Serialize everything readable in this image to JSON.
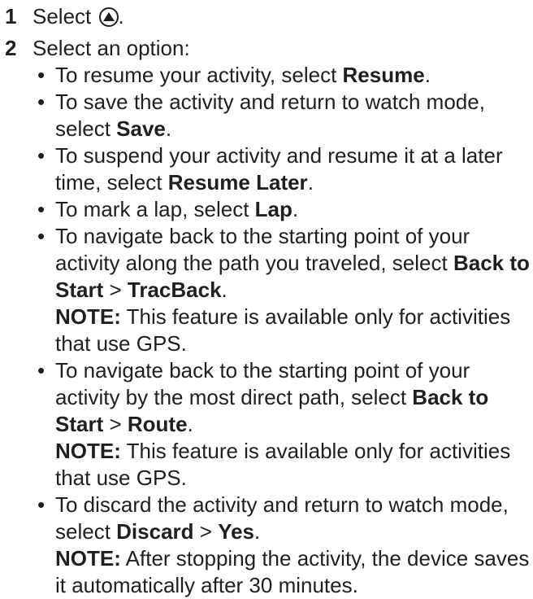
{
  "steps": [
    {
      "number": "1",
      "text_before": "Select ",
      "icon": "up-arrow-button-icon",
      "text_after": "."
    },
    {
      "number": "2",
      "text": "Select an option:",
      "options": [
        {
          "parts": [
            "To resume your activity, select ",
            "Resume",
            "."
          ]
        },
        {
          "parts": [
            "To save the activity and return to watch mode, select ",
            "Save",
            "."
          ]
        },
        {
          "parts": [
            "To suspend your activity and resume it at a later time, select ",
            "Resume Later",
            "."
          ]
        },
        {
          "parts": [
            "To mark a lap, select ",
            "Lap",
            "."
          ]
        },
        {
          "parts": [
            "To navigate back to the starting point of your activity along the path you traveled, select ",
            "Back to Start",
            " > ",
            "TracBack",
            "."
          ],
          "note_label": "NOTE:",
          "note_text": " This feature is available only for activities that use GPS."
        },
        {
          "parts": [
            "To navigate back to the starting point of your activity by the most direct path, select ",
            "Back to Start",
            " > ",
            "Route",
            "."
          ],
          "note_label": "NOTE:",
          "note_text": " This feature is available only for activities that use GPS."
        },
        {
          "parts": [
            "To discard the activity and return to watch mode, select ",
            "Discard",
            " > ",
            "Yes",
            "."
          ],
          "note_label": "NOTE:",
          "note_text": " After stopping the activity, the device saves it automatically after 30 minutes."
        }
      ]
    }
  ],
  "bullet_char": "•"
}
